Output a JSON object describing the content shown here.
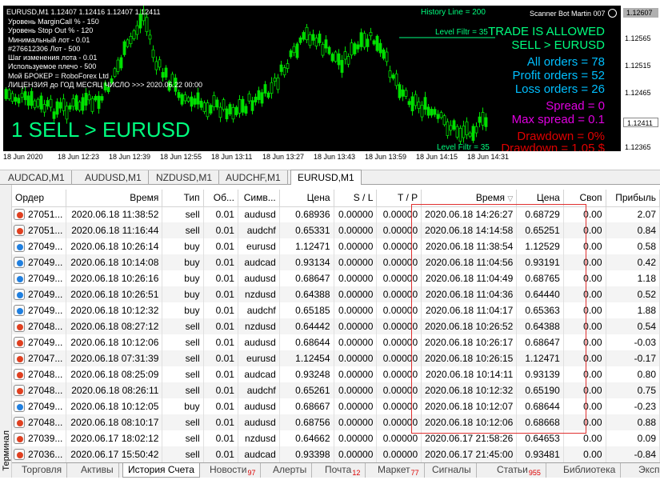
{
  "chart": {
    "symbol_line": "EURUSD,M1  1.12407 1.12416 1.12407 1.12411",
    "info_lines": [
      "Уровень MarginCall % - 150",
      "Уровень Stop Out % - 120",
      "Минимальный лот - 0.01",
      "#276612306 Лот - 500",
      "Шаг изменения лота - 0.01",
      "Используемое плечо - 500",
      "Мой БРОКЕР = RoboForex Ltd",
      "ЛИЦЕНЗИЯ до ГОД  МЕСЯЦ  ЧИСЛО >>> 2020.06.22 00:00"
    ],
    "big_signal": "1 SELL > EURUSD",
    "history_line": "History Line = 200",
    "level_filter_top": "Level Filtr = 35",
    "level_filter_bottom": "Level Filtr = 35",
    "scanner": "Scanner Bot Martin 007",
    "trade_status": "TRADE IS ALLOWED",
    "sell_label": "SELL > EURUSD",
    "all_orders": "All orders = 78",
    "profit_orders": "Profit orders = 52",
    "loss_orders": "Loss orders = 26",
    "spread": "Spread = 0",
    "max_spread": "Max spread = 0.1",
    "drawdown": "Drawdown = 0%",
    "drawdown_money": "Drawdown = 1.05 $",
    "y_ticks": [
      "1.12607",
      "1.12565",
      "1.12515",
      "1.12465",
      "1.12411",
      "1.12365"
    ],
    "y_high_label": "1.12607",
    "y_current_label": "1.12411",
    "x_ticks": [
      "18 Jun 2020",
      "18 Jun 12:23",
      "18 Jun 12:39",
      "18 Jun 12:55",
      "18 Jun 13:11",
      "18 Jun 13:27",
      "18 Jun 13:43",
      "18 Jun 13:59",
      "18 Jun 14:15",
      "18 Jun 14:31"
    ],
    "colors": {
      "candle": "#00e000",
      "signal": "#00ff7f",
      "cyan": "#00bfff",
      "magenta": "#e000e0",
      "red": "#e00000",
      "price_bg": "#b0b0b0"
    }
  },
  "chart_tabs": [
    "AUDCAD,M1",
    "AUDUSD,M1",
    "NZDUSD,M1",
    "AUDCHF,M1",
    "EURUSD,M1"
  ],
  "active_chart_tab": "EURUSD,M1",
  "terminal": {
    "side_label": "Терминал",
    "columns": [
      "Ордер",
      "Время",
      "Тип",
      "Об...",
      "Симв...",
      "Цена",
      "S / L",
      "T / P",
      "Время",
      "Цена",
      "Своп",
      "Прибыль"
    ],
    "rows": [
      {
        "order": "27051...",
        "open_time": "2020.06.18 11:38:52",
        "type": "sell",
        "volume": "0.01",
        "symbol": "audusd",
        "open_price": "0.68936",
        "sl": "0.00000",
        "tp": "0.00000",
        "close_time": "2020.06.18 14:26:27",
        "close_price": "0.68729",
        "swap": "0.00",
        "profit": "2.07"
      },
      {
        "order": "27051...",
        "open_time": "2020.06.18 11:16:44",
        "type": "sell",
        "volume": "0.01",
        "symbol": "audchf",
        "open_price": "0.65331",
        "sl": "0.00000",
        "tp": "0.00000",
        "close_time": "2020.06.18 14:14:58",
        "close_price": "0.65251",
        "swap": "0.00",
        "profit": "0.84"
      },
      {
        "order": "27049...",
        "open_time": "2020.06.18 10:26:14",
        "type": "buy",
        "volume": "0.01",
        "symbol": "eurusd",
        "open_price": "1.12471",
        "sl": "0.00000",
        "tp": "0.00000",
        "close_time": "2020.06.18 11:38:54",
        "close_price": "1.12529",
        "swap": "0.00",
        "profit": "0.58"
      },
      {
        "order": "27049...",
        "open_time": "2020.06.18 10:14:08",
        "type": "buy",
        "volume": "0.01",
        "symbol": "audcad",
        "open_price": "0.93134",
        "sl": "0.00000",
        "tp": "0.00000",
        "close_time": "2020.06.18 11:04:56",
        "close_price": "0.93191",
        "swap": "0.00",
        "profit": "0.42"
      },
      {
        "order": "27049...",
        "open_time": "2020.06.18 10:26:16",
        "type": "buy",
        "volume": "0.01",
        "symbol": "audusd",
        "open_price": "0.68647",
        "sl": "0.00000",
        "tp": "0.00000",
        "close_time": "2020.06.18 11:04:49",
        "close_price": "0.68765",
        "swap": "0.00",
        "profit": "1.18"
      },
      {
        "order": "27049...",
        "open_time": "2020.06.18 10:26:51",
        "type": "buy",
        "volume": "0.01",
        "symbol": "nzdusd",
        "open_price": "0.64388",
        "sl": "0.00000",
        "tp": "0.00000",
        "close_time": "2020.06.18 11:04:36",
        "close_price": "0.64440",
        "swap": "0.00",
        "profit": "0.52"
      },
      {
        "order": "27049...",
        "open_time": "2020.06.18 10:12:32",
        "type": "buy",
        "volume": "0.01",
        "symbol": "audchf",
        "open_price": "0.65185",
        "sl": "0.00000",
        "tp": "0.00000",
        "close_time": "2020.06.18 11:04:17",
        "close_price": "0.65363",
        "swap": "0.00",
        "profit": "1.88"
      },
      {
        "order": "27048...",
        "open_time": "2020.06.18 08:27:12",
        "type": "sell",
        "volume": "0.01",
        "symbol": "nzdusd",
        "open_price": "0.64442",
        "sl": "0.00000",
        "tp": "0.00000",
        "close_time": "2020.06.18 10:26:52",
        "close_price": "0.64388",
        "swap": "0.00",
        "profit": "0.54"
      },
      {
        "order": "27049...",
        "open_time": "2020.06.18 10:12:06",
        "type": "sell",
        "volume": "0.01",
        "symbol": "audusd",
        "open_price": "0.68644",
        "sl": "0.00000",
        "tp": "0.00000",
        "close_time": "2020.06.18 10:26:17",
        "close_price": "0.68647",
        "swap": "0.00",
        "profit": "-0.03"
      },
      {
        "order": "27047...",
        "open_time": "2020.06.18 07:31:39",
        "type": "sell",
        "volume": "0.01",
        "symbol": "eurusd",
        "open_price": "1.12454",
        "sl": "0.00000",
        "tp": "0.00000",
        "close_time": "2020.06.18 10:26:15",
        "close_price": "1.12471",
        "swap": "0.00",
        "profit": "-0.17"
      },
      {
        "order": "27048...",
        "open_time": "2020.06.18 08:25:09",
        "type": "sell",
        "volume": "0.01",
        "symbol": "audcad",
        "open_price": "0.93248",
        "sl": "0.00000",
        "tp": "0.00000",
        "close_time": "2020.06.18 10:14:11",
        "close_price": "0.93139",
        "swap": "0.00",
        "profit": "0.80"
      },
      {
        "order": "27048...",
        "open_time": "2020.06.18 08:26:11",
        "type": "sell",
        "volume": "0.01",
        "symbol": "audchf",
        "open_price": "0.65261",
        "sl": "0.00000",
        "tp": "0.00000",
        "close_time": "2020.06.18 10:12:32",
        "close_price": "0.65190",
        "swap": "0.00",
        "profit": "0.75"
      },
      {
        "order": "27049...",
        "open_time": "2020.06.18 10:12:05",
        "type": "buy",
        "volume": "0.01",
        "symbol": "audusd",
        "open_price": "0.68667",
        "sl": "0.00000",
        "tp": "0.00000",
        "close_time": "2020.06.18 10:12:07",
        "close_price": "0.68644",
        "swap": "0.00",
        "profit": "-0.23"
      },
      {
        "order": "27048...",
        "open_time": "2020.06.18 08:10:17",
        "type": "sell",
        "volume": "0.01",
        "symbol": "audusd",
        "open_price": "0.68756",
        "sl": "0.00000",
        "tp": "0.00000",
        "close_time": "2020.06.18 10:12:06",
        "close_price": "0.68668",
        "swap": "0.00",
        "profit": "0.88"
      },
      {
        "order": "27039...",
        "open_time": "2020.06.17 18:02:12",
        "type": "sell",
        "volume": "0.01",
        "symbol": "nzdusd",
        "open_price": "0.64662",
        "sl": "0.00000",
        "tp": "0.00000",
        "close_time": "2020.06.17 21:58:26",
        "close_price": "0.64653",
        "swap": "0.00",
        "profit": "0.09"
      },
      {
        "order": "27036...",
        "open_time": "2020.06.17 15:50:42",
        "type": "sell",
        "volume": "0.01",
        "symbol": "audcad",
        "open_price": "0.93398",
        "sl": "0.00000",
        "tp": "0.00000",
        "close_time": "2020.06.17 21:45:00",
        "close_price": "0.93481",
        "swap": "0.00",
        "profit": "-0.84"
      }
    ]
  },
  "bottom_tabs": [
    {
      "label": "Торговля",
      "badge": ""
    },
    {
      "label": "Активы",
      "badge": ""
    },
    {
      "label": "История Счета",
      "badge": ""
    },
    {
      "label": "Новости",
      "badge": "97"
    },
    {
      "label": "Алерты",
      "badge": ""
    },
    {
      "label": "Почта",
      "badge": "12"
    },
    {
      "label": "Маркет",
      "badge": "77"
    },
    {
      "label": "Сигналы",
      "badge": ""
    },
    {
      "label": "Статьи",
      "badge": "955"
    },
    {
      "label": "Библиотека",
      "badge": ""
    },
    {
      "label": "Эксперты",
      "badge": ""
    }
  ],
  "active_bottom_tab": "История Счета"
}
